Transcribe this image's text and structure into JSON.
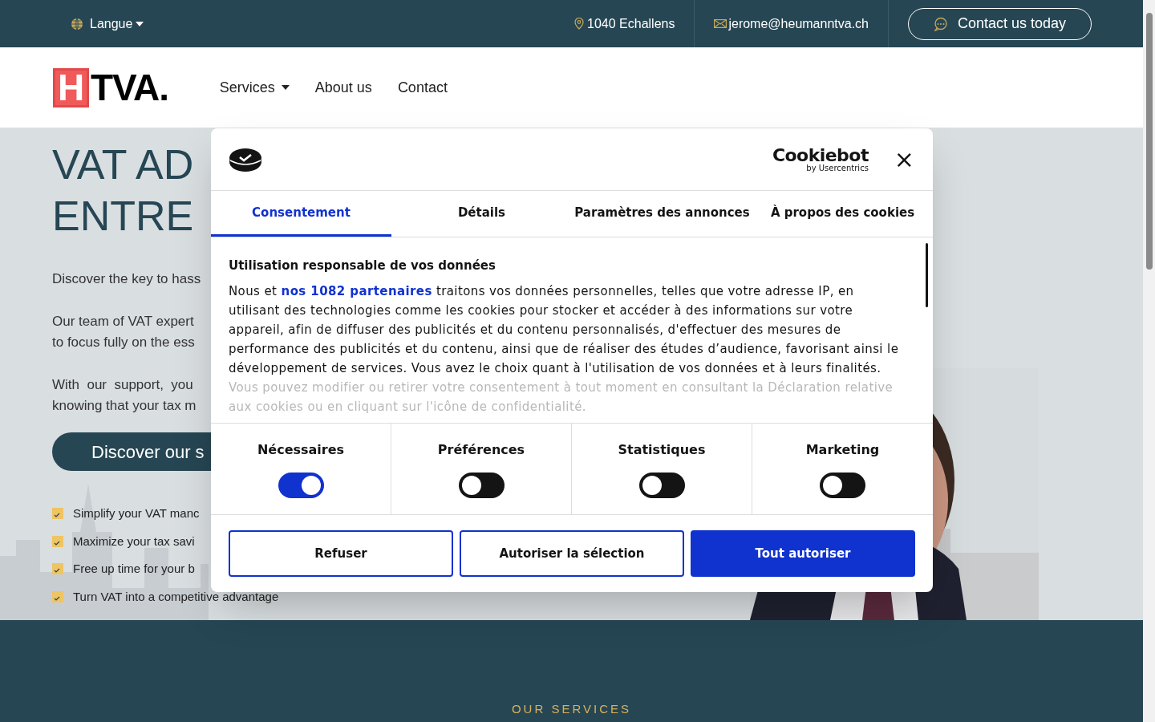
{
  "top_bar": {
    "language": "Langue",
    "location": "1040 Echallens",
    "email": "jerome@heumanntva.ch",
    "contact_button": "Contact us today"
  },
  "nav": {
    "logo_letter": "H",
    "logo_text": "TVA.",
    "items": [
      {
        "label": "Services",
        "dropdown": true
      },
      {
        "label": "About us",
        "dropdown": false
      },
      {
        "label": "Contact",
        "dropdown": false
      }
    ]
  },
  "hero": {
    "title_lines": [
      "VAT AD",
      "ENTRE"
    ],
    "paragraphs": [
      [
        "Discover the key to hass"
      ],
      [
        "Our team of VAT expert",
        "to focus fully on the ess"
      ],
      [
        "With  our  support,  you",
        "knowing that your tax m"
      ]
    ],
    "button": "Discover our s",
    "bullets": [
      "Simplify your VAT manc",
      "Maximize your tax savi",
      "Free up time for your b",
      "Turn VAT into a competitive advantage"
    ]
  },
  "services_section": {
    "eyebrow": "OUR SERVICES"
  },
  "cookie_dialog": {
    "brand": "Cookiebot",
    "brand_sub": "by Usercentrics",
    "close": "×",
    "tabs": [
      {
        "label": "Consentement",
        "selected": true
      },
      {
        "label": "Détails",
        "selected": false
      },
      {
        "label": "Paramètres des annonces",
        "selected": false
      },
      {
        "label": "À propos des cookies",
        "selected": false
      }
    ],
    "heading": "Utilisation responsable de vos données",
    "text_before": "Nous et ",
    "link": "nos 1082 partenaires",
    "text_after": " traitons vos données personnelles, telles que votre adresse IP, en utilisant des technologies comme les cookies pour stocker et accéder à des informations sur votre appareil, afin de diffuser des publicités et du contenu personnalisés, d'effectuer des mesures de performance des publicités et du contenu, ainsi que de réaliser des études d’audience, favorisant ainsi le développement de services. Vous avez le choix quant à l'utilisation de vos données et à leurs finalités.",
    "faded_text": "Vous pouvez modifier ou retirer votre consentement à tout moment en consultant la Déclaration relative aux cookies ou en cliquant sur l'icône de confidentialité.",
    "toggles": [
      {
        "label": "Nécessaires",
        "on": true
      },
      {
        "label": "Préférences",
        "on": false
      },
      {
        "label": "Statistiques",
        "on": false
      },
      {
        "label": "Marketing",
        "on": false
      }
    ],
    "buttons": [
      {
        "label": "Refuser",
        "kind": "outline"
      },
      {
        "label": "Autoriser la sélection",
        "kind": "outline"
      },
      {
        "label": "Tout autoriser",
        "kind": "primary"
      }
    ]
  }
}
